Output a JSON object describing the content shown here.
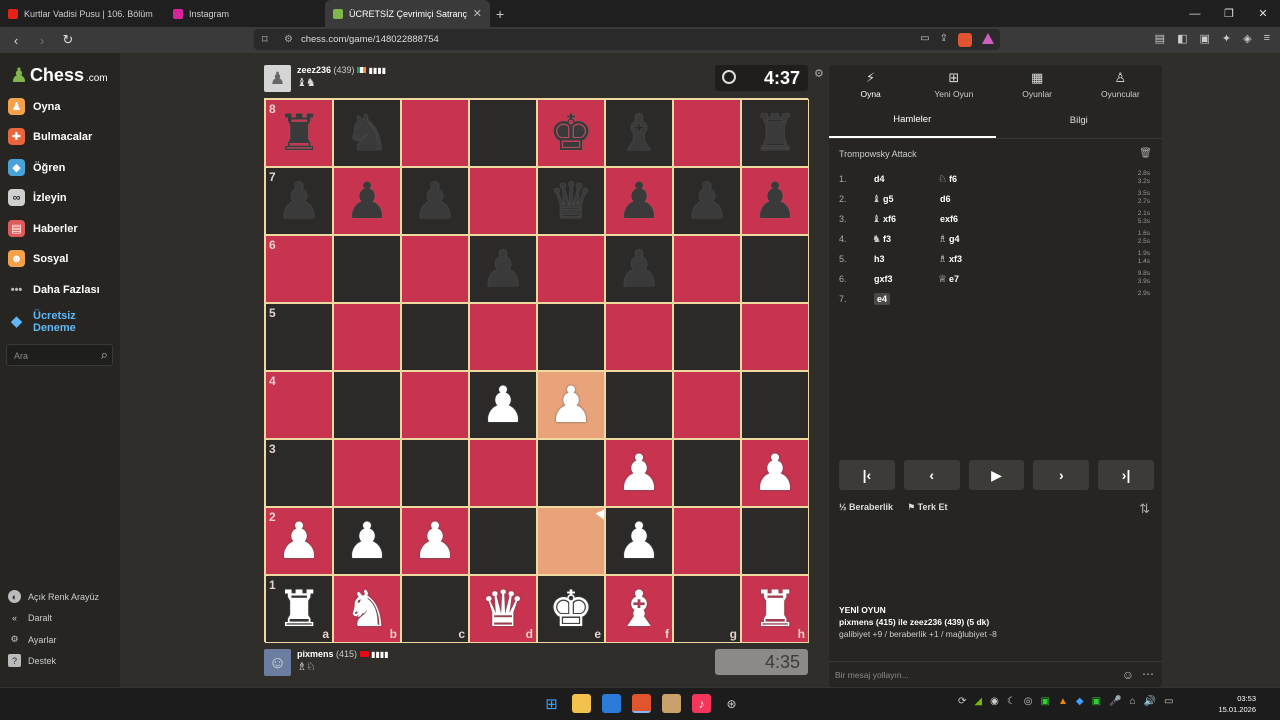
{
  "browser": {
    "tabs": [
      {
        "title": "Kurtlar Vadisi Pusu | 106. Bölüm | Yük",
        "color": "#e62117"
      },
      {
        "title": "Instagram",
        "color": "#d6249f"
      },
      {
        "title": "ÜCRETSİZ Çevrimiçi Satranç Oyn",
        "color": "#81b64c"
      }
    ],
    "url": "chess.com/game/148022888754"
  },
  "sidebar": {
    "logo": "Chess",
    "logo_suffix": ".com",
    "items": [
      {
        "label": "Oyna",
        "icon": "play-icon",
        "color": "#f3a14b"
      },
      {
        "label": "Bulmacalar",
        "icon": "puzzle-icon",
        "color": "#e9653b"
      },
      {
        "label": "Öğren",
        "icon": "learn-icon",
        "color": "#4aa3d8"
      },
      {
        "label": "İzleyin",
        "icon": "binoculars-icon",
        "color": "#cfcfcf"
      },
      {
        "label": "Haberler",
        "icon": "news-icon",
        "color": "#e05a5a"
      },
      {
        "label": "Sosyal",
        "icon": "social-icon",
        "color": "#f3a14b"
      },
      {
        "label": "Daha Fazlası",
        "icon": "more-icon",
        "color": "#bbbbbb"
      }
    ],
    "trial": "Ücretsiz Deneme",
    "search_placeholder": "Ara",
    "bottom": [
      {
        "label": "Açık Renk Arayüz",
        "icon": "theme-icon"
      },
      {
        "label": "Daralt",
        "icon": "collapse-icon"
      },
      {
        "label": "Ayarlar",
        "icon": "settings-icon"
      },
      {
        "label": "Destek",
        "icon": "help-icon"
      }
    ]
  },
  "top_player": {
    "name": "zeez236",
    "rating": "(439)",
    "clock": "4:37",
    "captured": "♝♞"
  },
  "bottom_player": {
    "name": "pixmens",
    "rating": "(415)",
    "clock": "4:35",
    "captured": "♗♘"
  },
  "board": {
    "light_color": "#c8334f",
    "dark_color": "#2b2a28",
    "highlight_color": "#e8a37a",
    "ranks": [
      "8",
      "7",
      "6",
      "5",
      "4",
      "3",
      "2",
      "1"
    ],
    "files": [
      "a",
      "b",
      "c",
      "d",
      "e",
      "f",
      "g",
      "h"
    ],
    "position": [
      [
        "r",
        "n",
        "",
        "",
        "k",
        "b",
        "",
        "r"
      ],
      [
        "p",
        "p",
        "p",
        "",
        "q",
        "p",
        "p",
        "p"
      ],
      [
        "",
        "",
        "",
        "p",
        "",
        "p",
        "",
        ""
      ],
      [
        "",
        "",
        "",
        "",
        "",
        "",
        "",
        ""
      ],
      [
        "",
        "",
        "",
        "P",
        "P",
        "",
        "",
        ""
      ],
      [
        "",
        "",
        "",
        "",
        "",
        "P",
        "",
        "P"
      ],
      [
        "P",
        "P",
        "P",
        "",
        "",
        "P",
        "",
        ""
      ],
      [
        "R",
        "N",
        "",
        "Q",
        "K",
        "B",
        "",
        "R"
      ]
    ],
    "highlights": [
      "e4",
      "e2"
    ]
  },
  "panel": {
    "tabs": [
      {
        "label": "Oyna",
        "icon": "bolt-icon"
      },
      {
        "label": "Yeni Oyun",
        "icon": "plus-icon"
      },
      {
        "label": "Oyunlar",
        "icon": "board-icon"
      },
      {
        "label": "Oyuncular",
        "icon": "players-icon"
      }
    ],
    "subtabs": [
      "Hamleler",
      "Bilgi"
    ],
    "opening": "Trompowsky Attack",
    "moves": [
      {
        "n": "1.",
        "w": "d4",
        "wp": "",
        "b": "f6",
        "bp": "♘",
        "t": [
          "2.8s",
          "3.2s"
        ]
      },
      {
        "n": "2.",
        "w": "g5",
        "wp": "♝",
        "b": "d6",
        "bp": "",
        "t": [
          "3.5s",
          "2.7s"
        ]
      },
      {
        "n": "3.",
        "w": "xf6",
        "wp": "♝",
        "b": "exf6",
        "bp": "",
        "t": [
          "2.1s",
          "5.3s"
        ]
      },
      {
        "n": "4.",
        "w": "f3",
        "wp": "♞",
        "b": "g4",
        "bp": "♗",
        "t": [
          "1.6s",
          "2.5s"
        ]
      },
      {
        "n": "5.",
        "w": "h3",
        "wp": "",
        "b": "xf3",
        "bp": "♗",
        "t": [
          "1.9s",
          "1.4s"
        ]
      },
      {
        "n": "6.",
        "w": "gxf3",
        "wp": "",
        "b": "e7",
        "bp": "♕",
        "t": [
          "9.8s",
          "3.9s"
        ]
      },
      {
        "n": "7.",
        "w": "e4",
        "wp": "",
        "b": "",
        "bp": "",
        "t": [
          "2.9s"
        ]
      }
    ],
    "draw": "Beraberlik",
    "resign": "Terk Et",
    "new_game_title": "YENİ OYUN",
    "new_game_line": "pixmens (415) ile zeez236 (439) (5 dk)",
    "new_game_stats": "galibiyet +9 / beraberlik +1 / mağlubiyet -8",
    "chat_placeholder": "Bir mesaj yollayın..."
  },
  "taskbar": {
    "time": "03:53",
    "date": "15.01.2026"
  }
}
